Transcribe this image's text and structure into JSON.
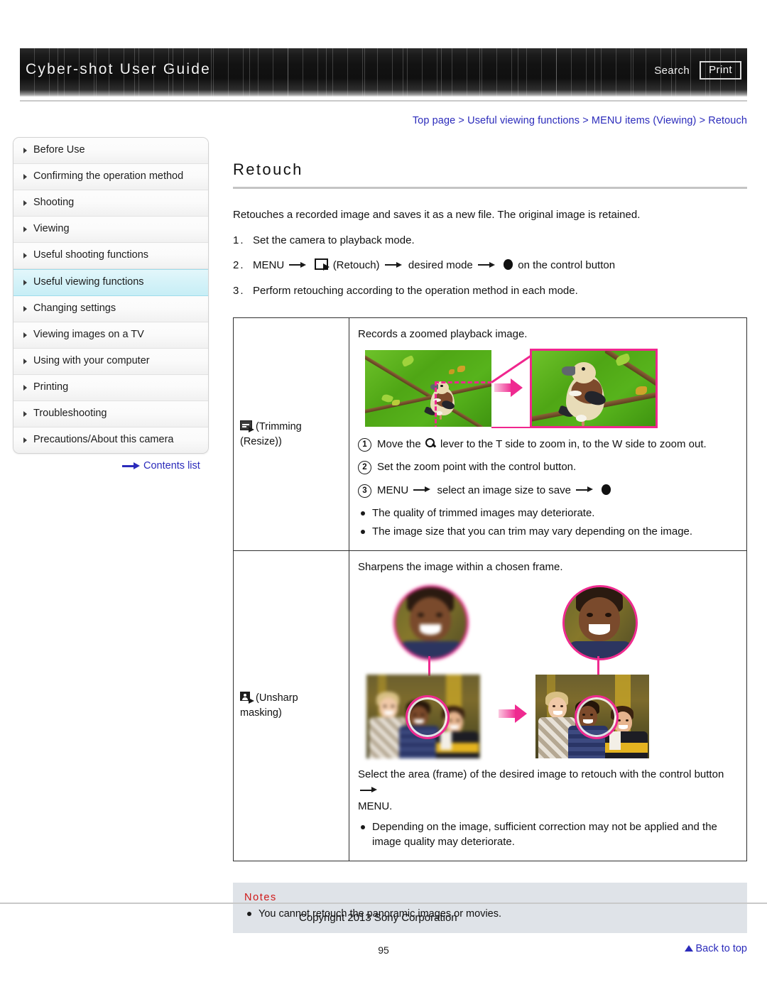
{
  "header": {
    "title": "Cyber-shot User Guide",
    "search_label": "Search",
    "print_label": "Print"
  },
  "breadcrumb": {
    "full": "Top page > Useful viewing functions > MENU items (Viewing) > Retouch",
    "items": [
      "Top page",
      "Useful viewing functions",
      "MENU items (Viewing)",
      "Retouch"
    ],
    "separator": ">",
    "color": "#2b2bbb"
  },
  "sidebar": {
    "items": [
      {
        "label": "Before Use",
        "active": false
      },
      {
        "label": "Confirming the operation method",
        "active": false
      },
      {
        "label": "Shooting",
        "active": false
      },
      {
        "label": "Viewing",
        "active": false
      },
      {
        "label": "Useful shooting functions",
        "active": false
      },
      {
        "label": "Useful viewing functions",
        "active": true
      },
      {
        "label": "Changing settings",
        "active": false
      },
      {
        "label": "Viewing images on a TV",
        "active": false
      },
      {
        "label": "Using with your computer",
        "active": false
      },
      {
        "label": "Printing",
        "active": false
      },
      {
        "label": "Troubleshooting",
        "active": false
      },
      {
        "label": "Precautions/About this camera",
        "active": false
      }
    ],
    "contents_link": "Contents list",
    "active_color": "#c7eef6"
  },
  "main": {
    "title": "Retouch",
    "intro": "Retouches a recorded image and saves it as a new file. The original image is retained.",
    "steps": [
      {
        "num": "1.",
        "text": "Set the camera to playback mode.",
        "parts": null
      },
      {
        "num": "2.",
        "prefix": "MENU",
        "mid": "(Retouch)",
        "mid2": "desired mode",
        "suffix": "on the control button"
      },
      {
        "num": "3.",
        "text": "Perform retouching according to the operation method in each mode."
      }
    ]
  },
  "mode_table": {
    "rows": [
      {
        "mode_label": "(Trimming (Resize))",
        "mode_label_line1": "(Trimming",
        "mode_label_line2": "(Resize))",
        "icon": "trimming-icon",
        "description": "Records a zoomed playback image.",
        "numbered": [
          {
            "n": "1",
            "pre": "Move the",
            "post": "lever to the T side to zoom in, to the W side to zoom out.",
            "glyph": "magnifier-icon"
          },
          {
            "n": "2",
            "pre": "Set the zoom point with the control button.",
            "post": "",
            "glyph": ""
          },
          {
            "n": "3",
            "pre": "MENU",
            "post": "select an image size to save",
            "glyph": "arrow-dot"
          }
        ],
        "bullets": [
          "The quality of trimmed images may deteriorate.",
          "The image size that you can trim may vary depending on the image."
        ]
      },
      {
        "mode_label": "(Unsharp masking)",
        "mode_label_line1": "(Unsharp",
        "mode_label_line2": "masking)",
        "icon": "unsharp-masking-icon",
        "description": "Sharpens the image within a chosen frame.",
        "body_line1": "Select the area (frame) of the desired image to retouch with the control button",
        "body_line2": "MENU.",
        "bullets": [
          "Depending on the image, sufficient correction may not be applied and the image quality may deteriorate."
        ]
      }
    ]
  },
  "notes": {
    "title": "Notes",
    "title_color": "#d01717",
    "items": [
      "You cannot retouch the panoramic images or movies."
    ]
  },
  "footer": {
    "back_to_top": "Back to top",
    "copyright": "Copyright 2013 Sony Corporation",
    "page_number": "95"
  },
  "colors": {
    "link": "#2b2bbb",
    "accent_pink": "#ef2a90",
    "notes_bg": "#dfe3e8",
    "header_dark": "#111111"
  }
}
